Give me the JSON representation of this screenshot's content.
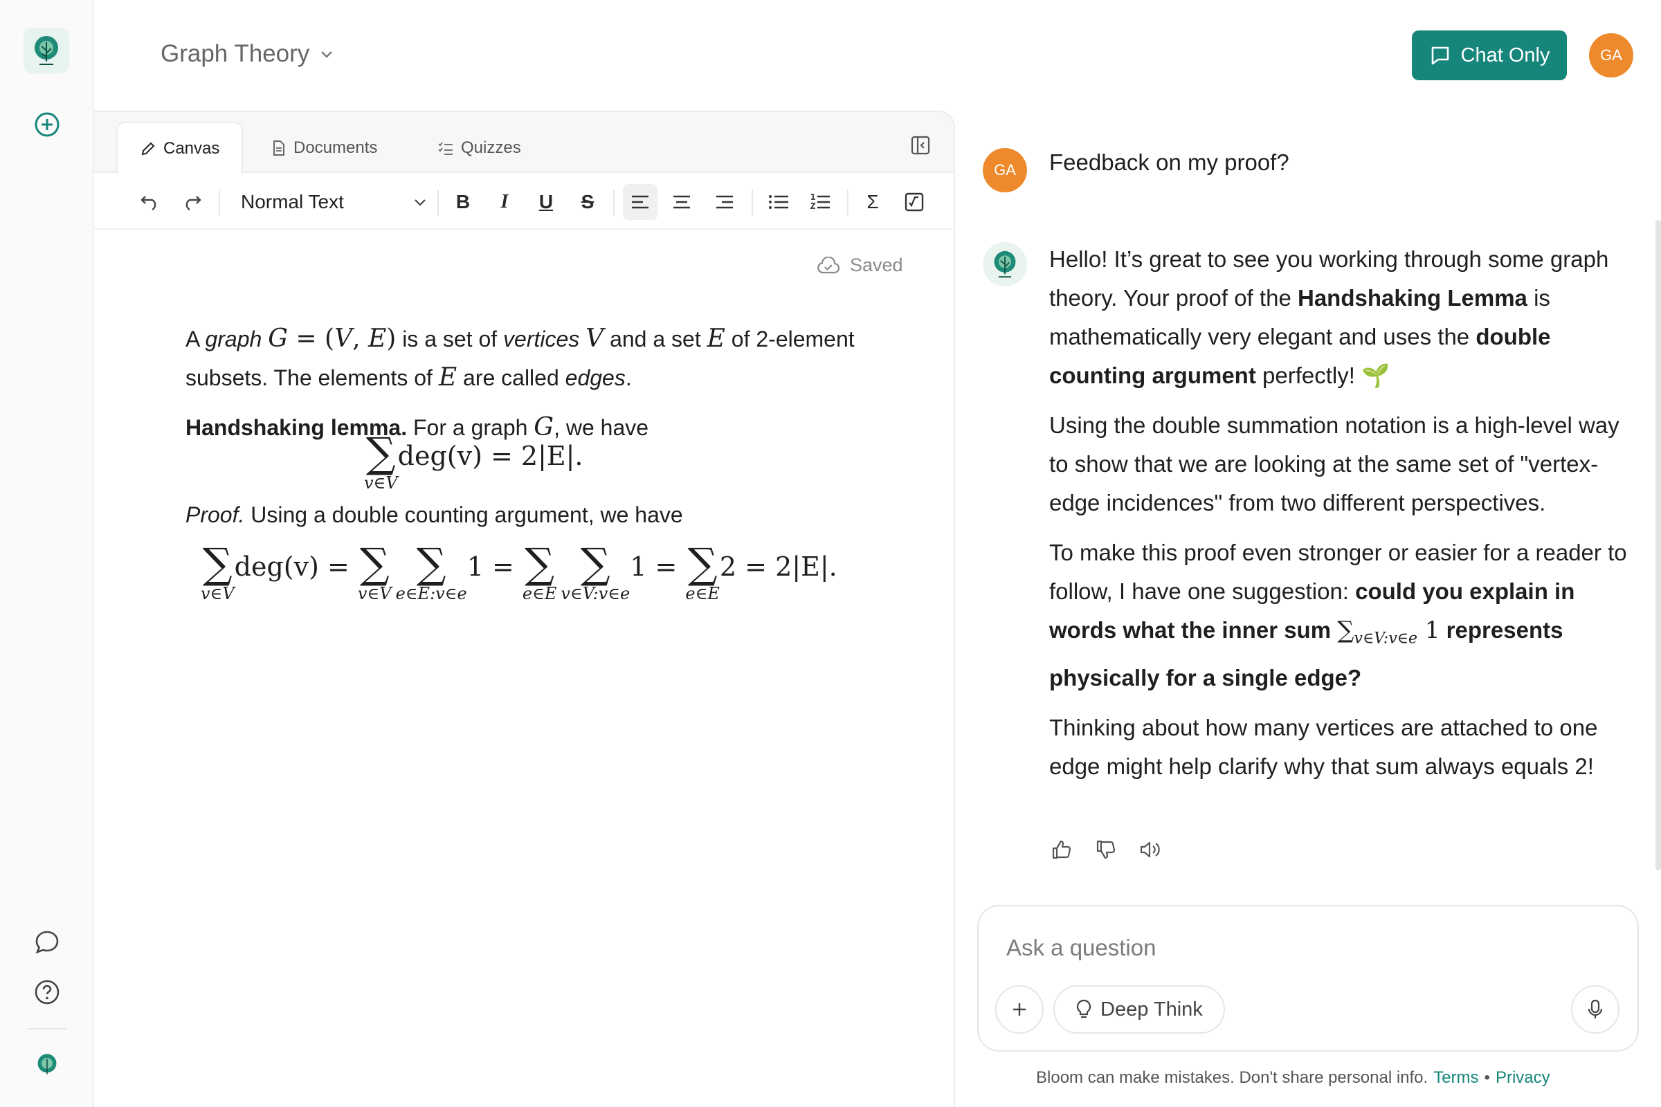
{
  "header": {
    "topic": "Graph Theory",
    "chat_only_label": "Chat Only",
    "user_initials": "GA"
  },
  "editor": {
    "tabs": [
      {
        "label": "Canvas",
        "icon": "pencil-icon",
        "active": true
      },
      {
        "label": "Documents",
        "icon": "document-icon",
        "active": false
      },
      {
        "label": "Quizzes",
        "icon": "checklist-icon",
        "active": false
      }
    ],
    "toolbar": {
      "text_style": "Normal Text",
      "bold_glyph": "B",
      "italic_glyph": "I",
      "underline_glyph": "U",
      "strike_glyph": "S",
      "sum_glyph": "Σ"
    },
    "save_status": "Saved",
    "content": {
      "p1_a": "A ",
      "p1_graph": "graph",
      "p1_b": " is a set of ",
      "p1_vertices": "vertices",
      "p1_c": " and a set ",
      "p1_d": " of 2-element subsets. The elements of ",
      "p1_e": " are called ",
      "p1_edges": "edges",
      "p1_f": ".",
      "p2_lemma": "Handshaking lemma.",
      "p2_a": " For a graph ",
      "p2_b": ", we have",
      "eq1_main": "deg(v) = 2|E|.",
      "eq1_sub": "v∈V",
      "p3_proof": "Proof.",
      "p3_text": " Using a double counting argument, we have",
      "eq2": {
        "t1": "deg(v) = ",
        "t2": "1 = ",
        "t3": "1 = ",
        "t4": "2 = 2|E|.",
        "s1": "v∈V",
        "s2": "v∈V",
        "s3": "e∈E:v∈e",
        "s4": "e∈E",
        "s5": "v∈V:v∈e",
        "s6": "e∈E"
      }
    }
  },
  "chat": {
    "user_message": "Feedback on my proof?",
    "bot": {
      "p1_a": "Hello! It’s great to see you working through some graph theory. Your proof of the ",
      "p1_b": "Handshaking Lemma",
      "p1_c": " is mathematically very elegant and uses the ",
      "p1_d": "double counting argument",
      "p1_e": " perfectly! 🌱",
      "p2": "Using the double summation notation is a high-level way to show that we are looking at the same set of \"vertex-edge incidences\" from two different perspectives.",
      "p3_a": "To make this proof even stronger or easier for a reader to follow, I have one suggestion: ",
      "p3_b": "could you explain in words what the inner sum ",
      "p3_sub": "v∈V:v∈e",
      "p3_one": " 1",
      "p3_c": " represents physically for a single edge?",
      "p4": "Thinking about how many vertices are attached to one edge might help clarify why that sum always equals 2!"
    },
    "composer": {
      "placeholder": "Ask a question",
      "deep_think_label": "Deep Think"
    },
    "disclaimer": {
      "text": "Bloom can make mistakes. Don't share personal info.",
      "terms": "Terms",
      "bullet": "•",
      "privacy": "Privacy"
    }
  },
  "colors": {
    "brand": "#16857a",
    "avatar": "#ee8a2b"
  }
}
